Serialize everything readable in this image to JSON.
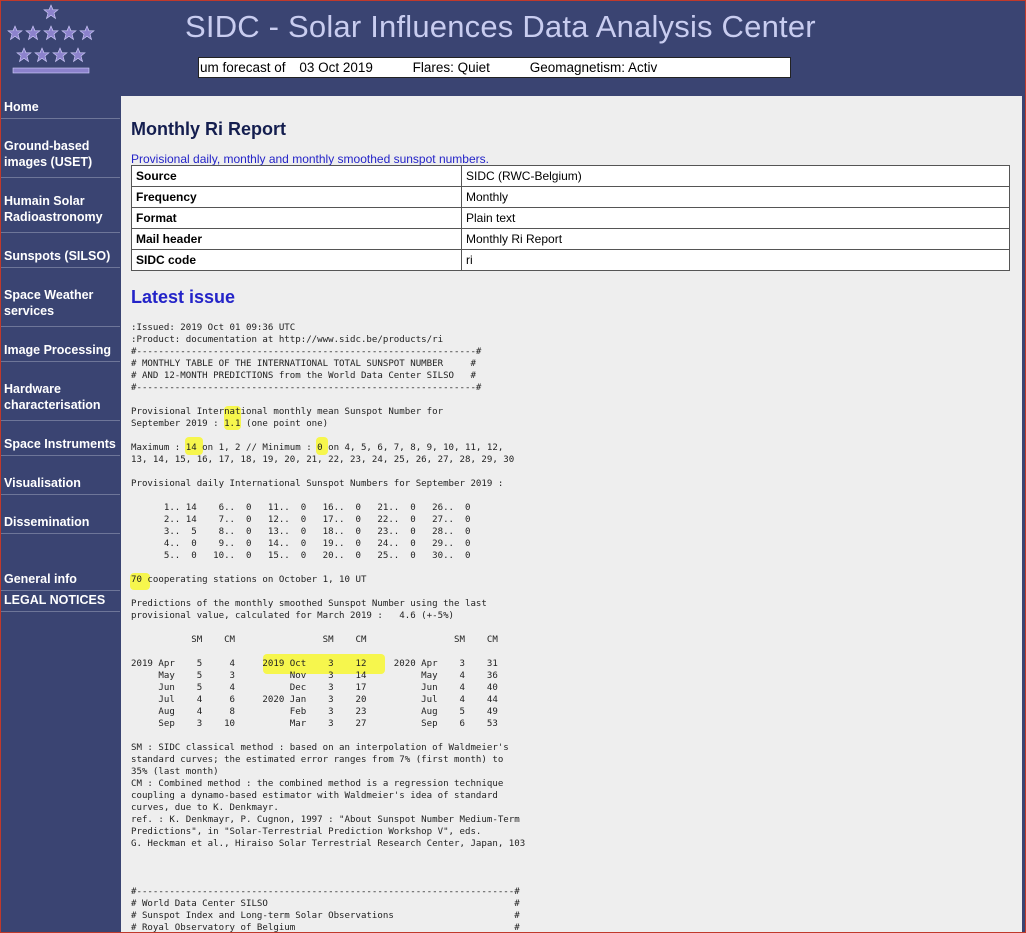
{
  "header": {
    "site_title": "SIDC - Solar Influences Data Analysis Center",
    "ticker": {
      "forecast_label": "um forecast of",
      "forecast_date": "03 Oct 2019",
      "flares": "Flares: Quiet",
      "geomagnetism": "Geomagnetism: Activ"
    }
  },
  "sidebar": {
    "items": [
      {
        "label": "Home"
      },
      {
        "label": "Ground-based images (USET)"
      },
      {
        "label": "Humain Solar Radioastronomy"
      },
      {
        "label": "Sunspots (SILSO)"
      },
      {
        "label": "Space Weather services"
      },
      {
        "label": "Image Processing"
      },
      {
        "label": "Hardware characterisation"
      },
      {
        "label": "Space Instruments"
      },
      {
        "label": "Visualisation"
      },
      {
        "label": "Dissemination"
      },
      {
        "label": "General info"
      },
      {
        "label": "LEGAL NOTICES"
      }
    ]
  },
  "main": {
    "title": "Monthly Ri Report",
    "description": "Provisional daily, monthly and monthly smoothed sunspot numbers.",
    "meta": [
      {
        "key": "Source",
        "value": "SIDC (RWC-Belgium)"
      },
      {
        "key": "Frequency",
        "value": "Monthly"
      },
      {
        "key": "Format",
        "value": "Plain text"
      },
      {
        "key": "Mail header",
        "value": "Monthly Ri Report"
      },
      {
        "key": "SIDC code",
        "value": "ri"
      }
    ],
    "latest_heading": "Latest issue",
    "report_text": ":Issued: 2019 Oct 01 09:36 UTC\n:Product: documentation at http://www.sidc.be/products/ri\n#--------------------------------------------------------------#\n# MONTHLY TABLE OF THE INTERNATIONAL TOTAL SUNSPOT NUMBER     #\n# AND 12-MONTH PREDICTIONS from the World Data Center SILSO   #\n#--------------------------------------------------------------#\n\nProvisional International monthly mean Sunspot Number for\nSeptember 2019 : 1.1 (one point one)\n\nMaximum : 14 on 1, 2 // Minimum : 0 on 4, 5, 6, 7, 8, 9, 10, 11, 12,\n13, 14, 15, 16, 17, 18, 19, 20, 21, 22, 23, 24, 25, 26, 27, 28, 29, 30\n\nProvisional daily International Sunspot Numbers for September 2019 :\n\n      1.. 14    6..  0   11..  0   16..  0   21..  0   26..  0\n      2.. 14    7..  0   12..  0   17..  0   22..  0   27..  0\n      3..  5    8..  0   13..  0   18..  0   23..  0   28..  0\n      4..  0    9..  0   14..  0   19..  0   24..  0   29..  0\n      5..  0   10..  0   15..  0   20..  0   25..  0   30..  0\n\n70 cooperating stations on October 1, 10 UT\n\nPredictions of the monthly smoothed Sunspot Number using the last\nprovisional value, calculated for March 2019 :   4.6 (+-5%)\n\n           SM    CM                SM    CM                SM    CM\n\n2019 Apr    5     4     2019 Oct    3    12     2020 Apr    3    31\n     May    5     3          Nov    3    14          May    4    36\n     Jun    5     4          Dec    3    17          Jun    4    40\n     Jul    4     6     2020 Jan    3    20          Jul    4    44\n     Aug    4     8          Feb    3    23          Aug    5    49\n     Sep    3    10          Mar    3    27          Sep    6    53\n\nSM : SIDC classical method : based on an interpolation of Waldmeier's\nstandard curves; the estimated error ranges from 7% (first month) to\n35% (last month)\nCM : Combined method : the combined method is a regression technique\ncoupling a dynamo-based estimator with Waldmeier's idea of standard\ncurves, due to K. Denkmayr.\nref. : K. Denkmayr, P. Cugnon, 1997 : \"About Sunspot Number Medium-Term\nPredictions\", in \"Solar-Terrestrial Prediction Workshop V\", eds.\nG. Heckman et al., Hiraiso Solar Terrestrial Research Center, Japan, 103\n\n\n\n#---------------------------------------------------------------------#\n# World Data Center SILSO                                             #\n# Sunspot Index and Long-term Solar Observations                      #\n# Royal Observatory of Belgium                                        #"
  },
  "colors": {
    "header_bg": "#3a4472",
    "title_color": "#c9cdf0",
    "content_bg": "#eeeeee",
    "link_blue": "#2424c8",
    "highlight": "#f7f730",
    "star": "#8c82cc"
  },
  "icons": {
    "logo": "stars-logo-icon"
  }
}
